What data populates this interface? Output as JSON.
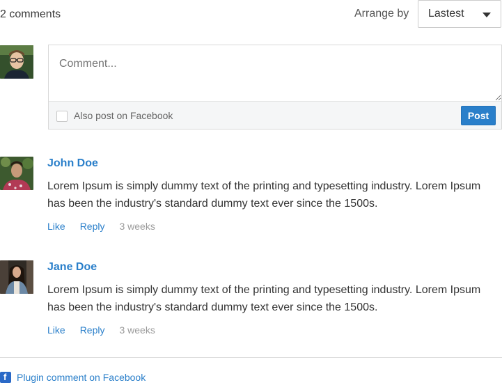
{
  "header": {
    "count": "2 comments",
    "arrange_label": "Arrange by",
    "sort_value": "Lastest"
  },
  "composer": {
    "placeholder": "Comment...",
    "checkbox_label": "Also post on Facebook",
    "post_label": "Post"
  },
  "comments": [
    {
      "author": "John Doe",
      "text": "Lorem Ipsum is simply dummy text of the printing and typesetting industry. Lorem Ipsum has been the industry's standard dummy text ever since the 1500s.",
      "like": "Like",
      "reply": "Reply",
      "time": "3 weeks"
    },
    {
      "author": "Jane Doe",
      "text": "Lorem Ipsum is simply dummy text of the printing and typesetting industry. Lorem Ipsum has been the industry's standard dummy text ever since the 1500s.",
      "like": "Like",
      "reply": "Reply",
      "time": "3 weeks"
    }
  ],
  "footer": {
    "icon": "facebook-icon",
    "text": "Plugin comment on Facebook"
  },
  "colors": {
    "accent": "#2a7fca",
    "facebook": "#2a69c7"
  }
}
